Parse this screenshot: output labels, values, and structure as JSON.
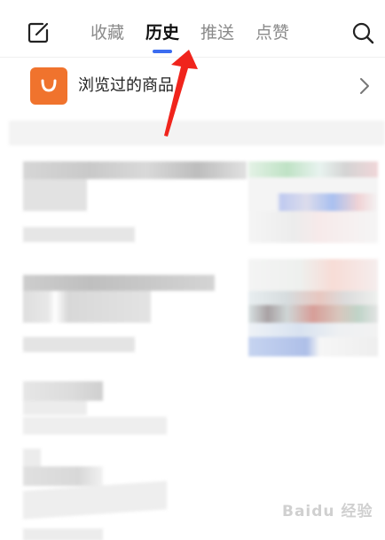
{
  "tabs": [
    {
      "label": "收藏",
      "active": false
    },
    {
      "label": "历史",
      "active": true
    },
    {
      "label": "推送",
      "active": false
    },
    {
      "label": "点赞",
      "active": false
    }
  ],
  "icons": {
    "edit": "edit-icon",
    "search": "search-icon",
    "shop": "shopping-bag-icon",
    "chevron": "chevron-right-icon",
    "annotation": "red-arrow-annotation"
  },
  "history_row": {
    "label": "浏览过的商品"
  },
  "colors": {
    "accent_tab_underline": "#3b6cf0",
    "shop_icon_bg": "#f0732d",
    "annotation_arrow": "#f0241c"
  },
  "watermark": {
    "text": "Baidu 经验"
  }
}
